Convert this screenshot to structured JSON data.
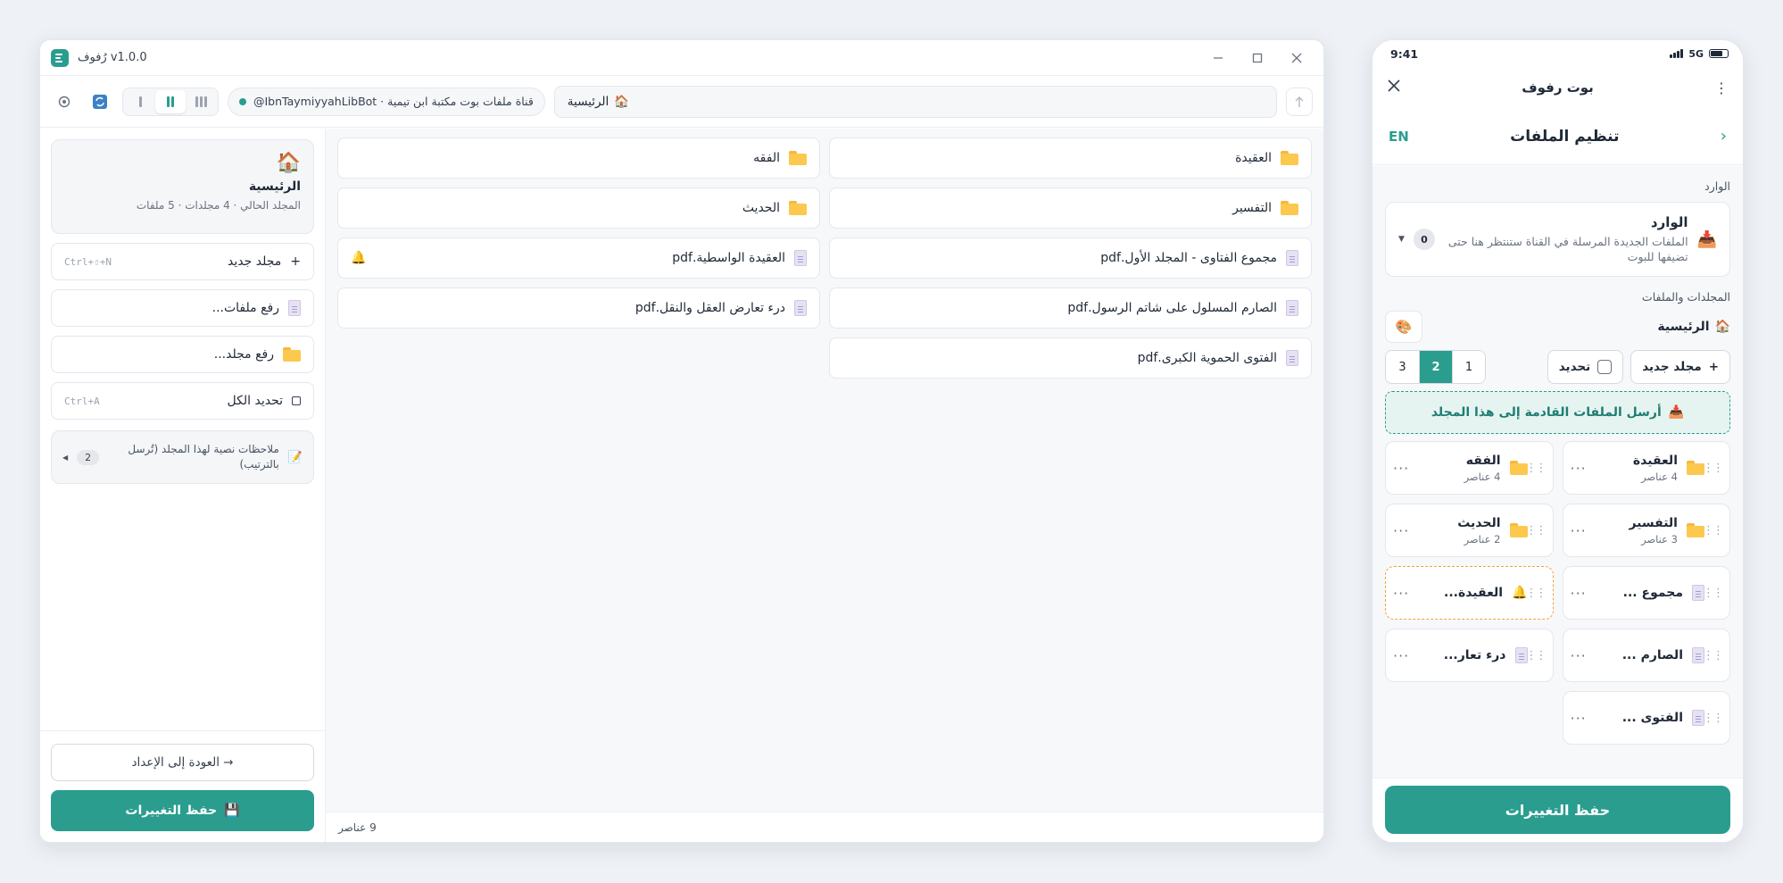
{
  "desktop": {
    "title": "رُفوف v1.0.0",
    "toolbar": {
      "channel": "@IbnTaymiyyahLibBot · قناة ملفات بوت مكتبة ابن تيمية",
      "path": "الرئيسية",
      "path_icon": "🏠"
    },
    "sidebar": {
      "current": {
        "icon": "🏠",
        "name": "الرئيسية",
        "meta": "المجلد الحالي · 4 مجلدات · 5 ملفات"
      },
      "actions": [
        {
          "label": "مجلد جديد",
          "icon": "+",
          "shortcut": "Ctrl+⇧+N"
        },
        {
          "label": "رفع ملفات...",
          "icon": "file",
          "shortcut": ""
        },
        {
          "label": "رفع مجلد...",
          "icon": "folder",
          "shortcut": ""
        },
        {
          "label": "تحديد الكل",
          "icon": "checkbox",
          "shortcut": "Ctrl+A"
        }
      ],
      "notes": {
        "label": "ملاحظات نصية لهذا المجلد (تُرسل بالترتيب)",
        "count": "2"
      },
      "back_label": "→ العودة إلى الإعداد",
      "save_label": "حفظ التغييرات"
    },
    "items": [
      {
        "name": "العقيدة",
        "type": "folder"
      },
      {
        "name": "الفقه",
        "type": "folder"
      },
      {
        "name": "التفسير",
        "type": "folder"
      },
      {
        "name": "الحديث",
        "type": "folder"
      },
      {
        "name": "مجموع الفتاوى - المجلد الأول.pdf",
        "type": "file"
      },
      {
        "name": "العقيدة الواسطية.pdf",
        "type": "file",
        "bell": true
      },
      {
        "name": "الصارم المسلول على شاتم الرسول.pdf",
        "type": "file"
      },
      {
        "name": "درء تعارض العقل والنقل.pdf",
        "type": "file"
      },
      {
        "name": "الفتوى الحموية الكبرى.pdf",
        "type": "file"
      }
    ],
    "status": "9 عناصر"
  },
  "phone": {
    "time": "9:41",
    "network": "5G",
    "header_title": "بوت رفوف",
    "sub_title": "تنظيم الملفات",
    "lang": "EN",
    "inbox_section": "الوارد",
    "inbox": {
      "title": "الوارد",
      "desc": "الملفات الجديدة المرسلة في القناة ستنتظر هنا حتى تضيفها للبوت",
      "count": "0"
    },
    "folders_section": "المجلدات والملفات",
    "crumb": "الرئيسية",
    "new_folder": "مجلد جديد",
    "select": "تحديد",
    "pages": [
      "1",
      "2",
      "3"
    ],
    "active_page": "2",
    "send_here": "أرسل الملفات القادمة إلى هذا المجلد",
    "cards": [
      {
        "name": "العقيدة",
        "count": "4 عناصر",
        "type": "folder"
      },
      {
        "name": "الفقه",
        "count": "4 عناصر",
        "type": "folder"
      },
      {
        "name": "التفسير",
        "count": "3 عناصر",
        "type": "folder"
      },
      {
        "name": "الحديث",
        "count": "2 عناصر",
        "type": "folder"
      },
      {
        "name": "مجموع ...",
        "count": "",
        "type": "file"
      },
      {
        "name": "العقيدة...",
        "count": "",
        "type": "file",
        "bell": true
      },
      {
        "name": "الصارم ...",
        "count": "",
        "type": "file"
      },
      {
        "name": "درء تعار...",
        "count": "",
        "type": "file"
      },
      {
        "name": "الفتوى ...",
        "count": "",
        "type": "file"
      }
    ],
    "save_label": "حفظ التغييرات"
  },
  "colors": {
    "accent": "#2a9d8f",
    "highlight": "#f0a23a",
    "folder": "#fcc84e"
  }
}
